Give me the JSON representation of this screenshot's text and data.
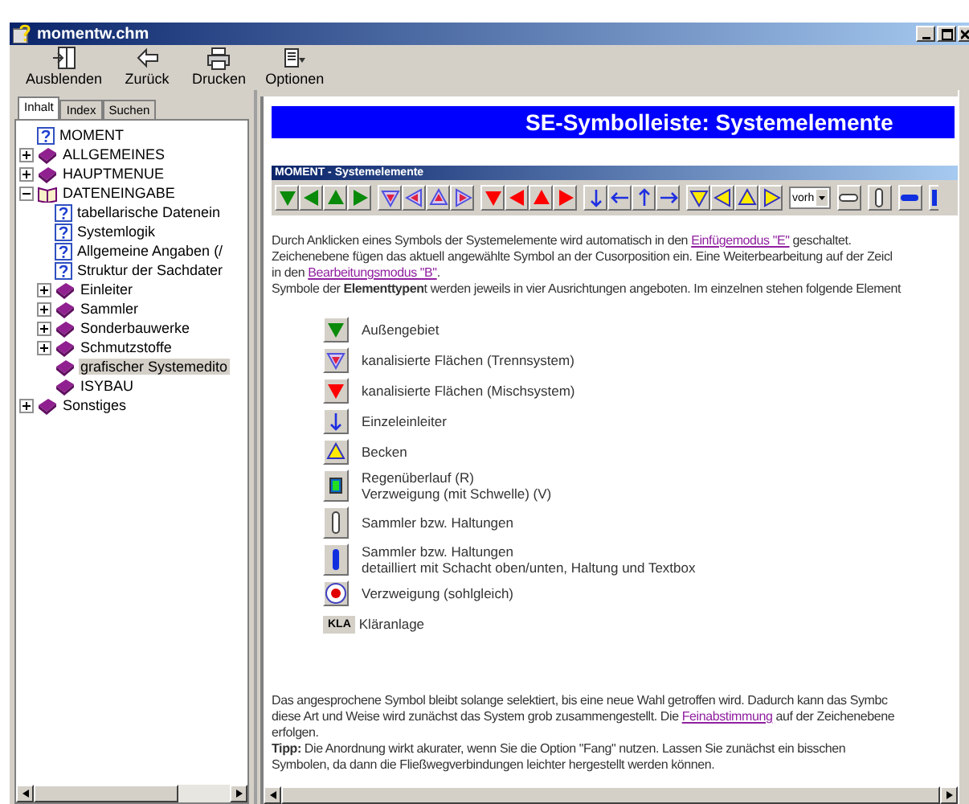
{
  "window": {
    "title": "momentw.chm"
  },
  "toolbar": [
    {
      "label": "Ausblenden",
      "kind": "hide"
    },
    {
      "label": "Zurück",
      "kind": "back"
    },
    {
      "label": "Drucken",
      "kind": "print"
    },
    {
      "label": "Optionen",
      "kind": "options"
    }
  ],
  "tabs": [
    {
      "label": "Inhalt",
      "selected": true
    },
    {
      "label": "Index",
      "selected": false
    },
    {
      "label": "Suchen",
      "selected": false
    }
  ],
  "tree": [
    {
      "label": "MOMENT",
      "kind": "page",
      "selected": false
    },
    {
      "label": "ALLGEMEINES",
      "kind": "book",
      "expanded": false,
      "selected": false
    },
    {
      "label": "HAUPTMENUE",
      "kind": "book",
      "expanded": false,
      "selected": false
    },
    {
      "label": "DATENEINGABE",
      "kind": "book",
      "expanded": true,
      "selected": false,
      "children": [
        {
          "label": "tabellarische Datenein",
          "kind": "page",
          "selected": false
        },
        {
          "label": "Systemlogik",
          "kind": "page",
          "selected": false
        },
        {
          "label": "Allgemeine Angaben (/",
          "kind": "page",
          "selected": false
        },
        {
          "label": "Struktur der Sachdater",
          "kind": "page",
          "selected": false
        },
        {
          "label": "Einleiter",
          "kind": "book",
          "expanded": false,
          "selected": false
        },
        {
          "label": "Sammler",
          "kind": "book",
          "expanded": false,
          "selected": false
        },
        {
          "label": "Sonderbauwerke",
          "kind": "book",
          "expanded": false,
          "selected": false
        },
        {
          "label": "Schmutzstoffe",
          "kind": "book",
          "expanded": false,
          "selected": false
        },
        {
          "label": "grafischer Systemedito",
          "kind": "book",
          "selected": true
        },
        {
          "label": "ISYBAU",
          "kind": "book",
          "selected": false
        }
      ]
    },
    {
      "label": "Sonstiges",
      "kind": "book",
      "expanded": false,
      "selected": false
    }
  ],
  "page": {
    "title": "SE-Symbolleiste: Systemelemente",
    "symbol_bar": {
      "title": "MOMENT - Systemelemente",
      "dropdown": "vorh"
    },
    "intro": [
      [
        {
          "kind": "text",
          "text": "Durch Anklicken eines Symbols der Systemelemente wird automatisch in den "
        },
        {
          "kind": "link",
          "text": "Einfügemodus \"E\""
        },
        {
          "kind": "text",
          "text": " geschaltet."
        }
      ],
      [
        {
          "kind": "text",
          "text": "Zeichenebene fügen das aktuell angewählte Symbol an der Cusorposition ein. Eine Weiterbearbeitung auf der Zeicl"
        }
      ],
      [
        {
          "kind": "text",
          "text": "in den "
        },
        {
          "kind": "link",
          "text": "Bearbeitungsmodus \"B\""
        },
        {
          "kind": "text",
          "text": "."
        }
      ],
      [
        {
          "kind": "text",
          "text": "Symbole der **Elementtypen**t werden jeweils in vier Ausrichtungen angeboten. Im einzelnen stehen folgende Element"
        }
      ]
    ],
    "legend": [
      {
        "kind": "green",
        "lines": [
          "Außengebiet"
        ]
      },
      {
        "kind": "separate",
        "lines": [
          "kanalisierte Flächen (Trennsystem)"
        ]
      },
      {
        "kind": "mixed",
        "lines": [
          "kanalisierte Flächen (Mischsystem)"
        ]
      },
      {
        "kind": "inlet",
        "lines": [
          "Einzeleinleiter"
        ]
      },
      {
        "kind": "basin",
        "lines": [
          "Becken"
        ]
      },
      {
        "kind": "overflow",
        "lines": [
          "Regenüberlauf (R)",
          "Verzweigung (mit Schwelle) (V)"
        ]
      },
      {
        "kind": "pipe",
        "lines": [
          "Sammler bzw. Haltungen"
        ]
      },
      {
        "kind": "pipe-detail",
        "lines": [
          "Sammler bzw. Haltungen",
          "detailliert mit Schacht oben/unten, Haltung und Textbox"
        ]
      },
      {
        "kind": "junction",
        "lines": [
          "Verzweigung (sohlgleich)"
        ]
      },
      {
        "kind": "plant",
        "badge": "KLA",
        "lines": [
          "Kläranlage"
        ]
      }
    ],
    "outro": [
      [
        {
          "kind": "text",
          "text": "Das angesprochene Symbol bleibt solange selektiert, bis eine neue Wahl getroffen wird. Dadurch kann das Symbc"
        }
      ],
      [
        {
          "kind": "text",
          "text": "diese Art und Weise wird zunächst das System grob zusammengestellt. Die "
        },
        {
          "kind": "link",
          "text": "Feinabstimmung"
        },
        {
          "kind": "text",
          "text": " auf der Zeichenebene"
        }
      ],
      [
        {
          "kind": "text",
          "text": "erfolgen."
        }
      ],
      [
        {
          "kind": "text",
          "text": "**Tipp:** Die Anordnung wirkt akurater, wenn Sie die Option \"Fang\" nutzen. Lassen Sie zunächst ein bisschen"
        }
      ],
      [
        {
          "kind": "text",
          "text": "Symbolen, da dann die Fließwegverbindungen leichter hergestellt werden können."
        }
      ]
    ]
  }
}
